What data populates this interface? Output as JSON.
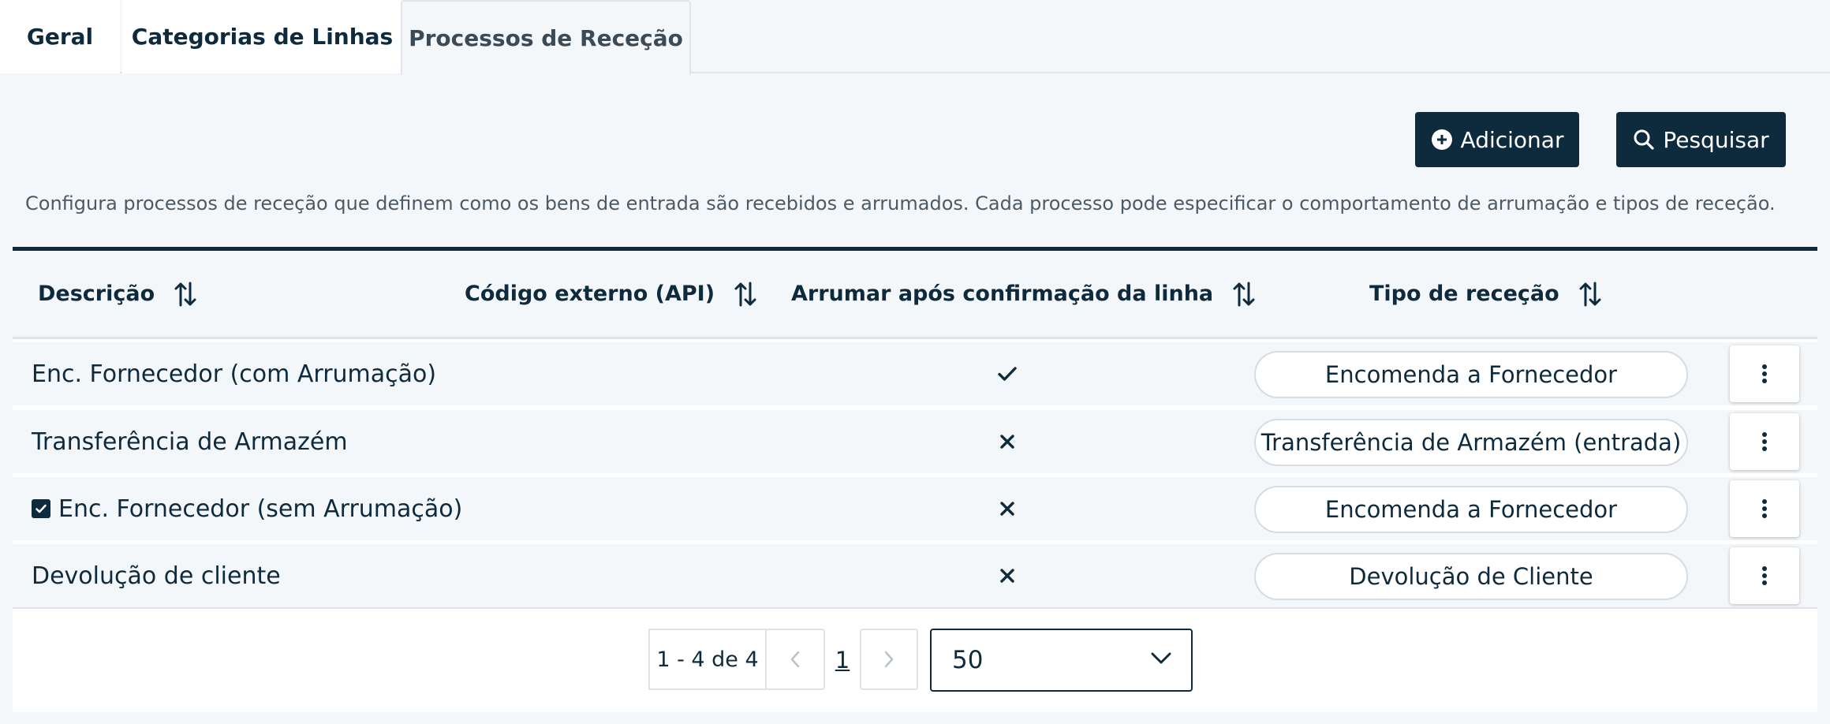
{
  "tabs": [
    {
      "label": "Geral"
    },
    {
      "label": "Categorias de Linhas"
    },
    {
      "label": "Processos de Receção"
    }
  ],
  "toolbar": {
    "add_label": "Adicionar",
    "search_label": "Pesquisar"
  },
  "description": "Configura processos de receção que definem como os bens de entrada são recebidos e arrumados. Cada processo pode especificar o comportamento de arrumação e tipos de receção.",
  "table": {
    "columns": [
      {
        "label": "Descrição"
      },
      {
        "label": "Código externo (API)"
      },
      {
        "label": "Arrumar após confirmação da linha"
      },
      {
        "label": "Tipo de receção"
      }
    ],
    "rows": [
      {
        "description": "Enc. Fornecedor (com Arrumação)",
        "external_code": "",
        "putaway": "check",
        "type": "Encomenda a Fornecedor",
        "selected": false
      },
      {
        "description": "Transferência de Armazém",
        "external_code": "",
        "putaway": "cross",
        "type": "Transferência de Armazém (entrada)",
        "selected": false
      },
      {
        "description": "Enc. Fornecedor (sem Arrumação)",
        "external_code": "",
        "putaway": "cross",
        "type": "Encomenda a Fornecedor",
        "selected": true
      },
      {
        "description": "Devolução de cliente",
        "external_code": "",
        "putaway": "cross",
        "type": "Devolução de Cliente",
        "selected": false
      }
    ]
  },
  "pagination": {
    "range": "1 - 4 de 4",
    "current_page": "1",
    "page_size": "50"
  },
  "colors": {
    "primary": "#0e2a3d",
    "background": "#f4f7fa",
    "border": "#dde3e9"
  },
  "icons": {
    "add": "plus-circle-icon",
    "search": "search-icon",
    "sort": "sort-icon",
    "check": "check-icon",
    "cross": "close-icon",
    "kebab": "more-vertical-icon",
    "prev": "chevron-left-icon",
    "next": "chevron-right-icon",
    "dropdown": "chevron-down-icon"
  }
}
